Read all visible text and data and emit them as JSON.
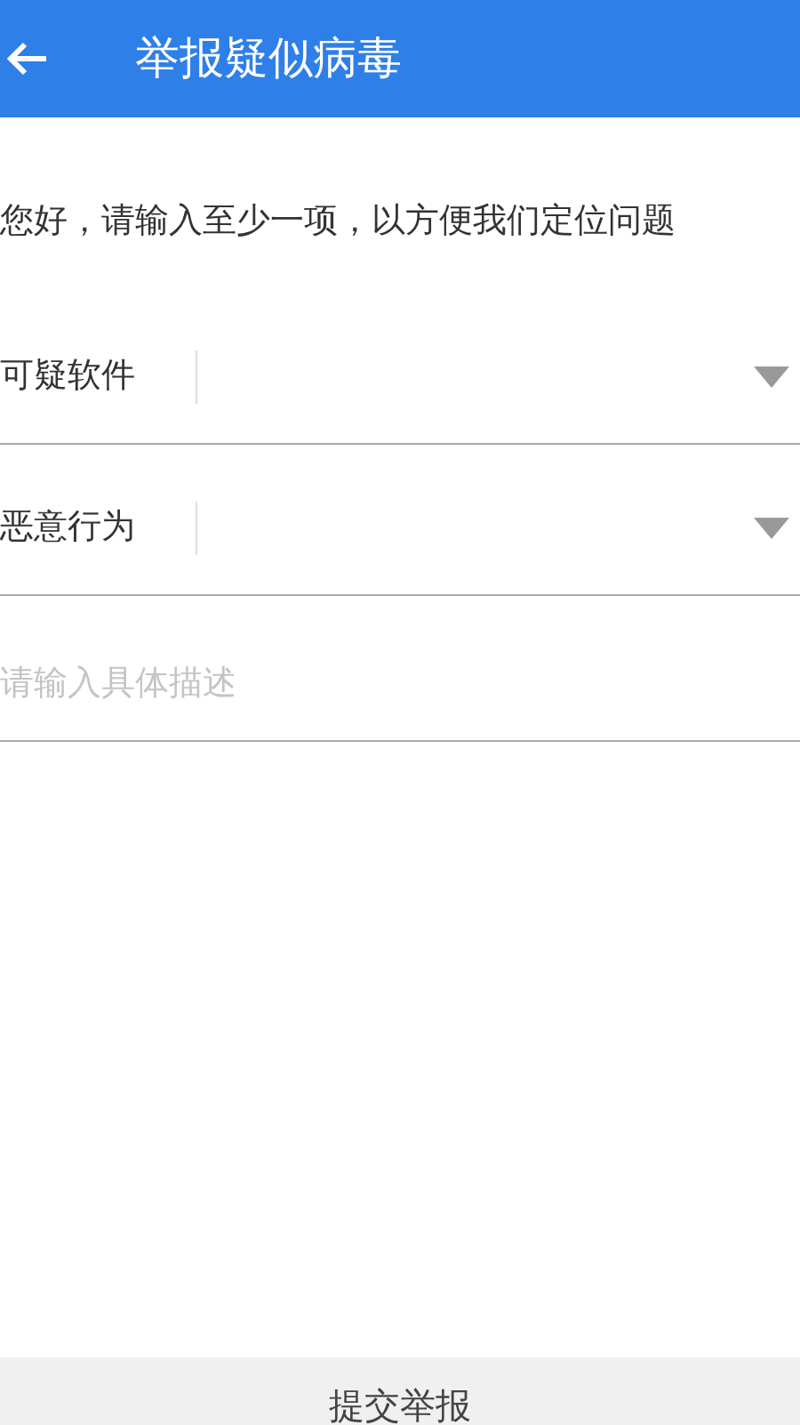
{
  "header": {
    "title": "举报疑似病毒"
  },
  "intro": "您好，请输入至少一项，以方便我们定位问题",
  "selects": [
    {
      "label": "可疑软件"
    },
    {
      "label": "恶意行为"
    }
  ],
  "description": {
    "placeholder": "请输入具体描述"
  },
  "submit": {
    "label": "提交举报"
  }
}
